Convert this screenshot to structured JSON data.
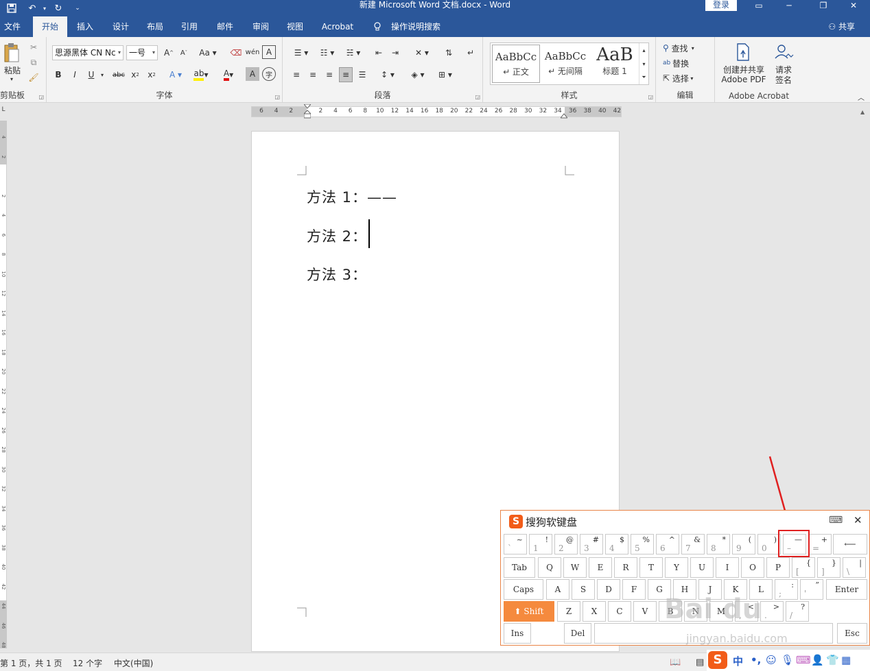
{
  "titlebar": {
    "title": "新建 Microsoft Word 文档.docx  -  Word",
    "login": "登录",
    "qa": {
      "save": "🖫",
      "undo": "↶",
      "redo": "↻",
      "customize": "⌄"
    },
    "win": {
      "ribbon_opts": "▭",
      "minimize": "─",
      "restore": "❐",
      "close": "✕"
    }
  },
  "tabs": {
    "items": [
      "文件",
      "开始",
      "插入",
      "设计",
      "布局",
      "引用",
      "邮件",
      "审阅",
      "视图",
      "Acrobat",
      "操作说明搜索"
    ],
    "share": "共享"
  },
  "ribbon": {
    "clipboard": {
      "label": "剪贴板",
      "paste": "粘贴"
    },
    "font": {
      "label": "字体",
      "font_name": "思源黑体 CN Nc",
      "font_size": "一号"
    },
    "paragraph": {
      "label": "段落"
    },
    "styles": {
      "label": "样式",
      "items": [
        {
          "sample": "AaBbCc",
          "name": "↵ 正文"
        },
        {
          "sample": "AaBbCc",
          "name": "↵ 无间隔"
        },
        {
          "sample": "AaB",
          "name": "标题 1"
        }
      ]
    },
    "editing": {
      "label": "编辑",
      "find": "查找",
      "replace": "替换",
      "select": "选择"
    },
    "acrobat": {
      "label": "Adobe Acrobat",
      "create_share": "创建并共享",
      "create_share2": "Adobe PDF",
      "request_sign": "请求",
      "request_sign2": "签名"
    }
  },
  "ruler": {
    "h_labels": [
      "6",
      "4",
      "2",
      "",
      "2",
      "4",
      "6",
      "8",
      "10",
      "12",
      "14",
      "16",
      "18",
      "20",
      "22",
      "24",
      "26",
      "28",
      "30",
      "32",
      "34",
      "36",
      "38",
      "40",
      "42"
    ],
    "v_labels": [
      "4",
      "2",
      "",
      "2",
      "4",
      "6",
      "8",
      "10",
      "12",
      "14",
      "16",
      "18",
      "20",
      "22",
      "24",
      "26",
      "28",
      "30",
      "32",
      "34",
      "36",
      "38",
      "40",
      "42",
      "44",
      "46",
      "48"
    ],
    "corner": "L"
  },
  "document": {
    "paragraphs": [
      "方法 1：——",
      "方法 2：",
      "方法 3："
    ]
  },
  "status": {
    "page": "第 1 页，共 1 页",
    "words": "12 个字",
    "lang": "中文(中国)"
  },
  "keyboard": {
    "title": "搜狗软键盘",
    "rows": [
      [
        {
          "u": "~",
          "d": "`"
        },
        {
          "u": "!",
          "d": "1"
        },
        {
          "u": "@",
          "d": "2"
        },
        {
          "u": "#",
          "d": "3"
        },
        {
          "u": "$",
          "d": "4"
        },
        {
          "u": "%",
          "d": "5"
        },
        {
          "u": "^",
          "d": "6"
        },
        {
          "u": "&",
          "d": "7"
        },
        {
          "u": "*",
          "d": "8"
        },
        {
          "u": "(",
          "d": "9"
        },
        {
          "u": ")",
          "d": "0"
        },
        {
          "u": "—",
          "d": "–"
        },
        {
          "u": "+",
          "d": "="
        },
        {
          "m": "⟵"
        }
      ],
      [
        {
          "m": "Tab"
        },
        {
          "m": "Q"
        },
        {
          "m": "W"
        },
        {
          "m": "E"
        },
        {
          "m": "R"
        },
        {
          "m": "T"
        },
        {
          "m": "Y"
        },
        {
          "m": "U"
        },
        {
          "m": "I"
        },
        {
          "m": "O"
        },
        {
          "m": "P"
        },
        {
          "u": "{",
          "d": "["
        },
        {
          "u": "}",
          "d": "]"
        },
        {
          "u": "|",
          "d": "\\"
        }
      ],
      [
        {
          "m": "Caps"
        },
        {
          "m": "A"
        },
        {
          "m": "S"
        },
        {
          "m": "D"
        },
        {
          "m": "F"
        },
        {
          "m": "G"
        },
        {
          "m": "H"
        },
        {
          "m": "J"
        },
        {
          "m": "K"
        },
        {
          "m": "L"
        },
        {
          "u": ":",
          "d": ";"
        },
        {
          "u": "”",
          "d": "'"
        },
        {
          "m": "Enter"
        }
      ],
      [
        {
          "m": "⬆ Shift"
        },
        {
          "m": "Z"
        },
        {
          "m": "X"
        },
        {
          "m": "C"
        },
        {
          "m": "V"
        },
        {
          "m": "B"
        },
        {
          "m": "N"
        },
        {
          "m": "M"
        },
        {
          "u": "<",
          "d": ","
        },
        {
          "u": ">",
          "d": "."
        },
        {
          "u": "?",
          "d": "/"
        }
      ],
      [
        {
          "m": "Ins"
        },
        {
          "m": "Del"
        },
        {
          "m": " "
        },
        {
          "m": "Esc"
        }
      ]
    ]
  },
  "tray": {
    "lang": "中",
    "punct": "•,",
    "emoji": "☺",
    "mic": "🎤"
  },
  "watermark": {
    "text": "Bai du",
    "sub": "jingyan.baidu.com"
  },
  "colors": {
    "word_blue": "#2b579a",
    "sogou_orange": "#f25c19",
    "highlight_red": "#e02020"
  }
}
